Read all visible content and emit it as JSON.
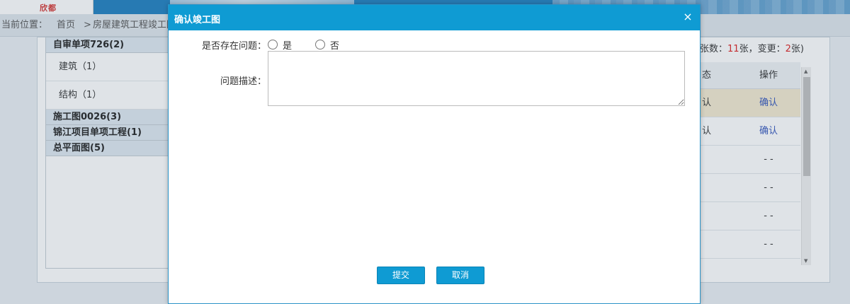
{
  "app": {
    "logo_text": "欣都"
  },
  "breadcrumb": {
    "prefix": "当前位置：",
    "home": "首页",
    "separator": ">",
    "current": "房屋建筑工程竣工图"
  },
  "tree": {
    "groups": [
      {
        "label": "自审单项726(2)",
        "items": [
          "建筑（1）",
          "结构（1）"
        ]
      },
      {
        "label": "施工图0026(3)",
        "items": []
      },
      {
        "label": "锦江项目单项工程(1)",
        "items": []
      },
      {
        "label": "总平面图(5)",
        "items": []
      }
    ]
  },
  "summary": {
    "part1": "张数：",
    "count": "11",
    "part2": "张，变更：",
    "changes": "2",
    "part3": "张)"
  },
  "table": {
    "headers": [
      "态",
      "操作"
    ],
    "rows": [
      {
        "status": "认",
        "action": "确认",
        "highlight": true
      },
      {
        "status": "认",
        "action": "确认",
        "highlight": false
      },
      {
        "status": "",
        "action": "- -",
        "highlight": false
      },
      {
        "status": "",
        "action": "- -",
        "highlight": false
      },
      {
        "status": "",
        "action": "- -",
        "highlight": false
      },
      {
        "status": "",
        "action": "- -",
        "highlight": false
      }
    ]
  },
  "modal": {
    "title": "确认竣工图",
    "close_symbol": "×",
    "question_label": "是否存在问题：",
    "options": [
      {
        "label": "是",
        "selected": false
      },
      {
        "label": "否",
        "selected": false
      }
    ],
    "description_label": "问题描述：",
    "description_value": "",
    "submit_label": "提交",
    "cancel_label": "取消"
  },
  "colors": {
    "modal_header": "#0f9bd3",
    "button": "#0f9bd3",
    "highlight_row": "#f3ead0",
    "link": "#3355bb",
    "count_red": "#d22222"
  }
}
